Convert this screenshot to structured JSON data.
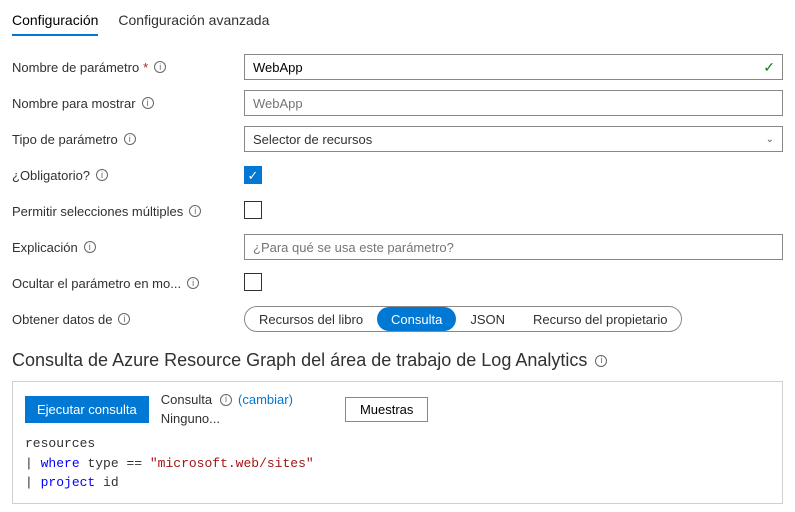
{
  "tabs": {
    "config": "Configuración",
    "advanced": "Configuración avanzada"
  },
  "labels": {
    "paramName": "Nombre de parámetro",
    "displayName": "Nombre para mostrar",
    "paramType": "Tipo de parámetro",
    "required": "¿Obligatorio?",
    "multi": "Permitir selecciones múltiples",
    "explanation": "Explicación",
    "hide": "Ocultar el parámetro en mo...",
    "getFrom": "Obtener datos de"
  },
  "values": {
    "paramName": "WebApp",
    "displayNamePlaceholder": "WebApp",
    "paramType": "Selector de recursos",
    "explanationPlaceholder": "¿Para qué se usa este parámetro?"
  },
  "pills": {
    "book": "Recursos del libro",
    "query": "Consulta",
    "json": "JSON",
    "owner": "Recurso del propietario"
  },
  "sectionTitle": "Consulta de Azure Resource Graph del área de trabajo de Log Analytics",
  "queryBar": {
    "run": "Ejecutar consulta",
    "consulta": "Consulta",
    "change": "(cambiar)",
    "ninguno": "Ninguno...",
    "samples": "Muestras"
  },
  "query": {
    "line1": "resources",
    "kw_where": "where",
    "kw_project": "project",
    "type_eq": "type ==",
    "str_site": "\"microsoft.web/sites\"",
    "id": "id"
  }
}
